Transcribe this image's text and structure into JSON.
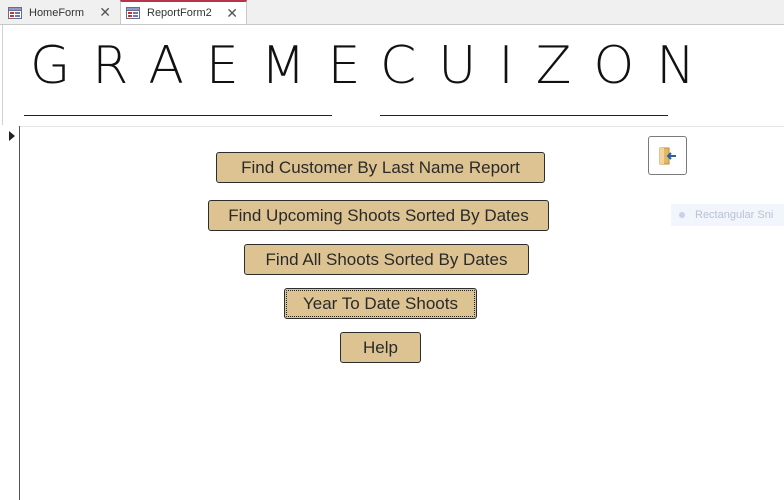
{
  "tabs": [
    {
      "label": "HomeForm",
      "active": false,
      "icon": "form-icon",
      "close_icon": "close-icon"
    },
    {
      "label": "ReportForm2",
      "active": true,
      "icon": "form-icon",
      "close_icon": "close-icon"
    }
  ],
  "header": {
    "first_name": "GRAEME",
    "last_name": "CUIZON"
  },
  "buttons": {
    "find_customer": "Find Customer By Last Name Report",
    "find_upcoming": "Find Upcoming Shoots Sorted By Dates",
    "find_all": "Find All Shoots Sorted By Dates",
    "year_to_date": "Year To Date Shoots",
    "help": "Help"
  },
  "exit_button": {
    "icon": "exit-door-icon"
  },
  "overlay": {
    "text": "Rectangular Sni"
  },
  "colors": {
    "button_fill": "#dcc391",
    "button_border": "#2d2d2d",
    "active_tab_accent": "#b8344a"
  }
}
